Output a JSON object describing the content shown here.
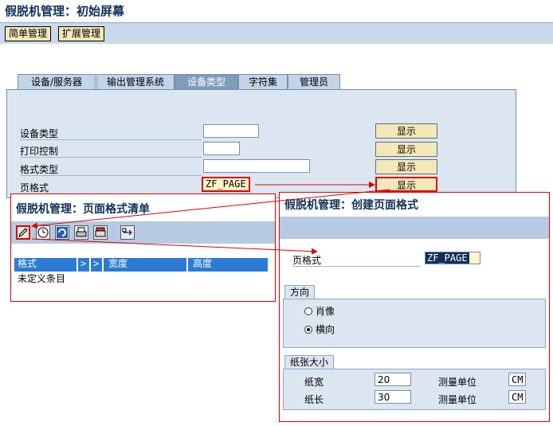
{
  "title": "假脱机管理：初始屏幕",
  "toolbar": {
    "simple_label": "简单管理",
    "extended_label": "扩展管理"
  },
  "tabs": [
    "设备/服务器",
    "输出管理系统",
    "设备类型",
    "字符集",
    "管理员"
  ],
  "active_tab": 2,
  "form": {
    "rows": [
      {
        "label": "设备类型",
        "value": "",
        "button": "显示"
      },
      {
        "label": "打印控制",
        "value": "",
        "button": "显示"
      },
      {
        "label": "格式类型",
        "value": "",
        "button": "显示"
      },
      {
        "label": "页格式",
        "value": "ZF_PAGE",
        "button": "显示"
      }
    ]
  },
  "list_window": {
    "title": "假脱机管理：页面格式清单",
    "icons": [
      "pencil-icon",
      "clock-icon",
      "refresh-icon",
      "print-icon",
      "print-preview-icon",
      "transport-icon"
    ],
    "columns": [
      "格式",
      ">",
      ">",
      "宽度",
      "高度"
    ],
    "empty_text": "未定义条目"
  },
  "create_window": {
    "title": "假脱机管理：创建页面格式",
    "page_format_label": "页格式",
    "page_format_value": "ZF_PAGE",
    "orientation": {
      "group_label": "方向",
      "options": [
        "肖像",
        "横向"
      ],
      "selected": 1
    },
    "paper": {
      "group_label": "纸张大小",
      "width_label": "纸宽",
      "width_value": "20",
      "length_label": "纸长",
      "length_value": "30",
      "unit_label": "测量单位",
      "unit_value": "CM"
    }
  },
  "colors": {
    "annotation_red": "#e00000",
    "button_yellow": "#f4e7b8",
    "panel_blue": "#dbe6f1",
    "header_blue": "#2b7bd5"
  }
}
